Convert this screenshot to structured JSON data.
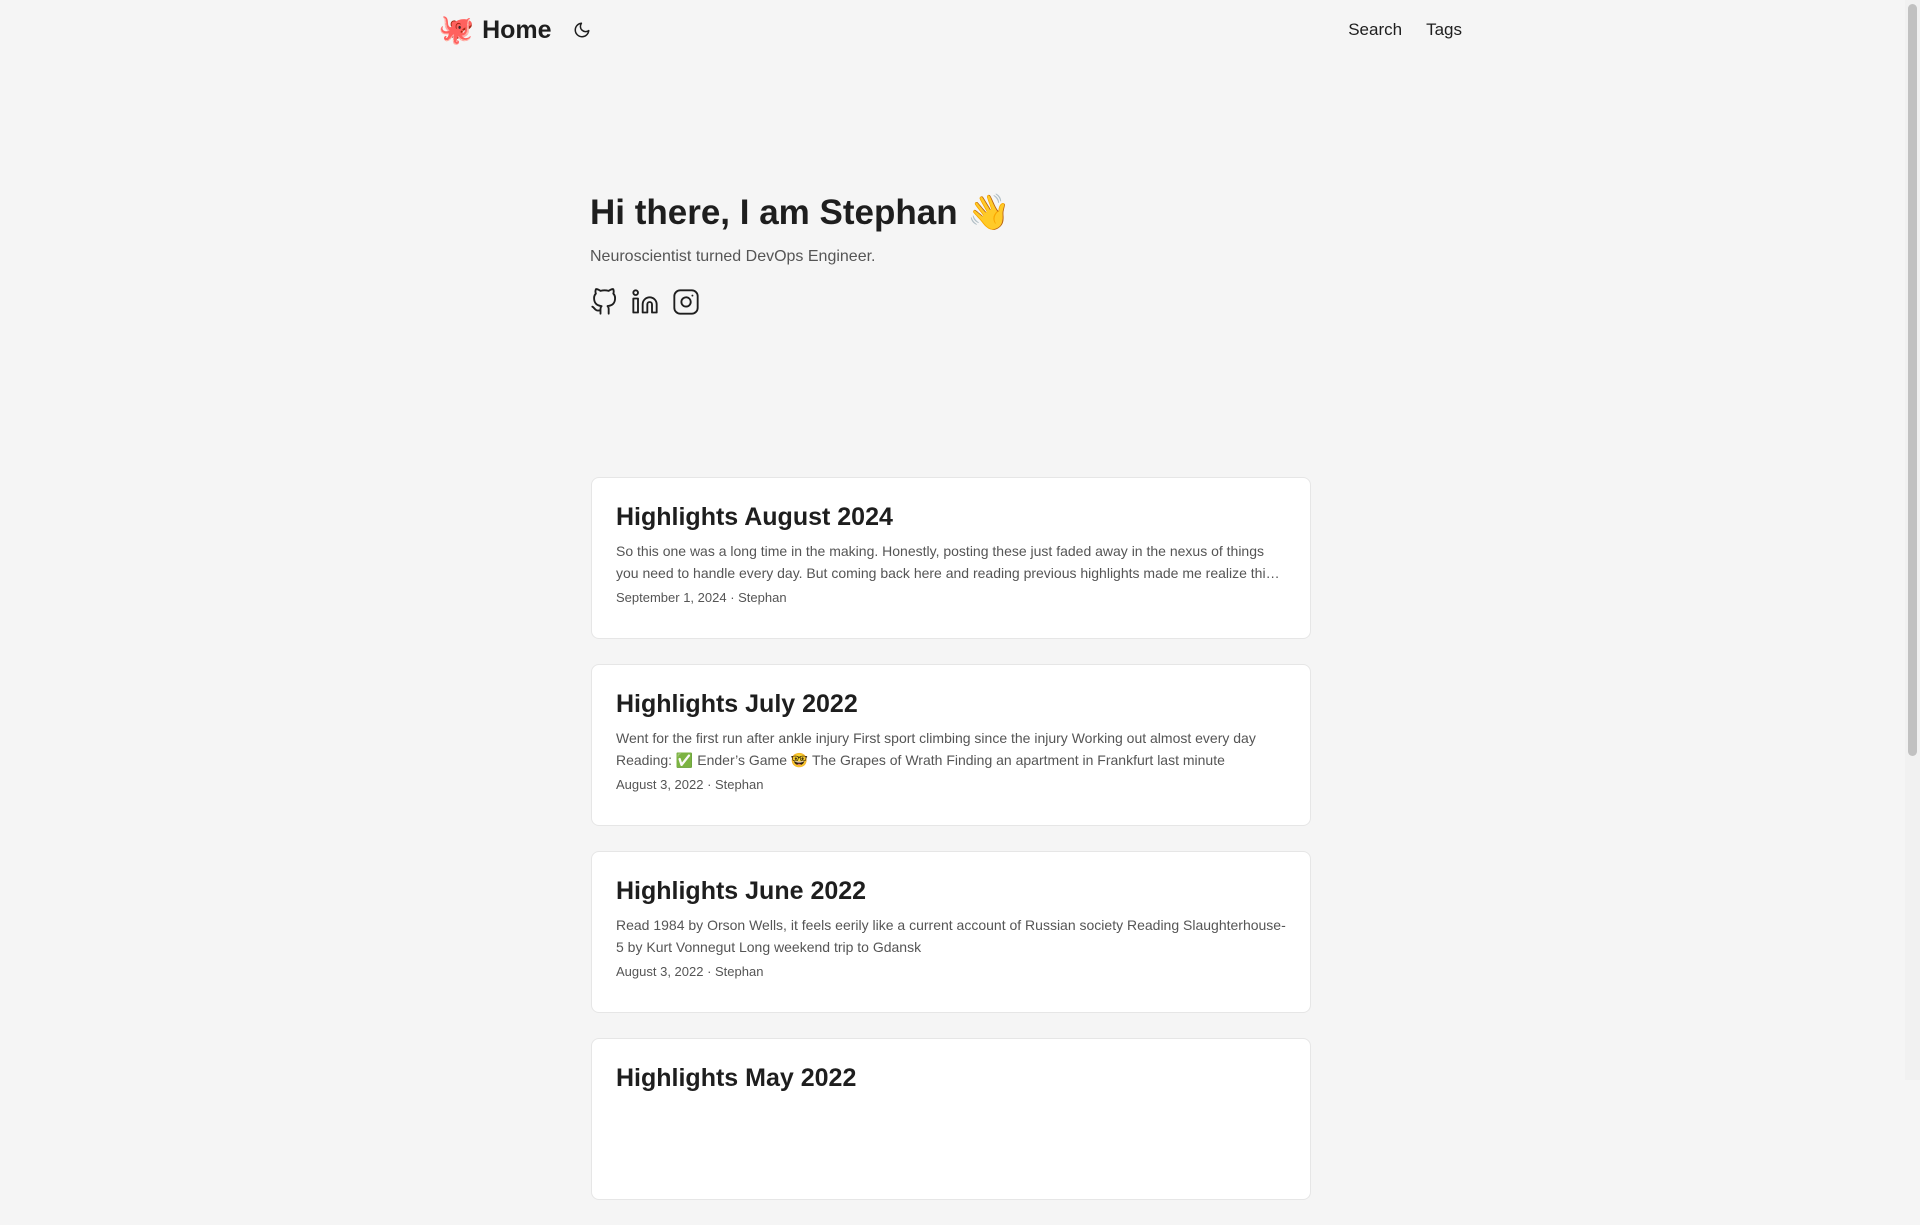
{
  "header": {
    "logo_emoji": "🐙",
    "home_label": "Home",
    "theme_icon": "moon-icon",
    "menu": [
      {
        "label": "Search"
      },
      {
        "label": "Tags"
      }
    ]
  },
  "hero": {
    "title": "Hi there, I am Stephan 👋",
    "subtitle": "Neuroscientist turned DevOps Engineer.",
    "socials": [
      {
        "icon": "github-icon"
      },
      {
        "icon": "linkedin-icon"
      },
      {
        "icon": "instagram-icon"
      }
    ]
  },
  "posts": [
    {
      "title": "Highlights August 2024",
      "excerpt": "So this one was a long time in the making. Honestly, posting these just faded away in the nexus of things you need to handle every day. But coming back here and reading previous highlights made me realize this is",
      "meta": "September 1, 2024 · Stephan"
    },
    {
      "title": "Highlights July 2022",
      "excerpt": "Went for the first run after ankle injury First sport climbing since the injury Working out almost every day Reading: ✅ Ender’s Game 🤓 The Grapes of Wrath Finding an apartment in Frankfurt last minute",
      "meta": "August 3, 2022 · Stephan"
    },
    {
      "title": "Highlights June 2022",
      "excerpt": "Read 1984 by Orson Wells, it feels eerily like a current account of Russian society Reading Slaughterhouse-5 by Kurt Vonnegut Long weekend trip to Gdansk",
      "meta": "August 3, 2022 · Stephan"
    },
    {
      "title": "Highlights May 2022",
      "excerpt": "",
      "meta": ""
    }
  ]
}
